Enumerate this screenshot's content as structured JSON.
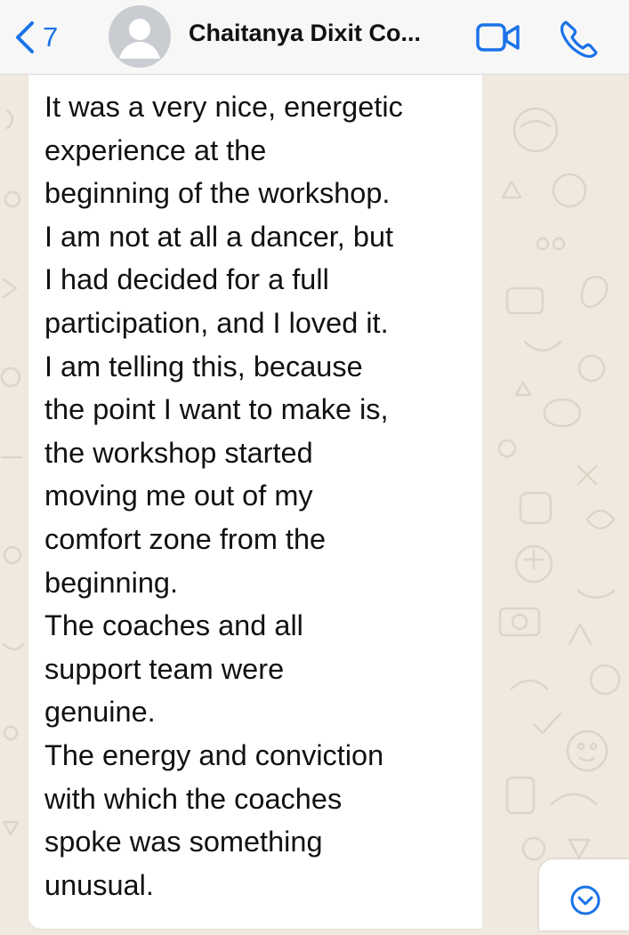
{
  "header": {
    "back_count": "7",
    "contact_name": "Chaitanya Dixit Co..."
  },
  "icons": {
    "back": "chevron-left-icon",
    "avatar": "person-silhouette-icon",
    "video": "video-camera-icon",
    "call": "phone-icon",
    "scroll": "chevron-down-circle-icon"
  },
  "colors": {
    "accent": "#1a73e8",
    "header_bg": "#f7f7f7",
    "chat_bg": "#efe9df",
    "bubble_bg": "#ffffff",
    "text": "#111111"
  },
  "message": {
    "text": "It was a very nice, energetic\nexperience at the\nbeginning of the workshop.\nI am not at all a dancer, but\nI had decided for a full\nparticipation, and I loved it.\nI am telling this, because\nthe point I want to make is,\nthe workshop started\nmoving me out of my\ncomfort zone from the\nbeginning.\nThe coaches and all\nsupport team were\ngenuine.\nThe energy and conviction\nwith which the coaches\nspoke was something\nunusual."
  }
}
